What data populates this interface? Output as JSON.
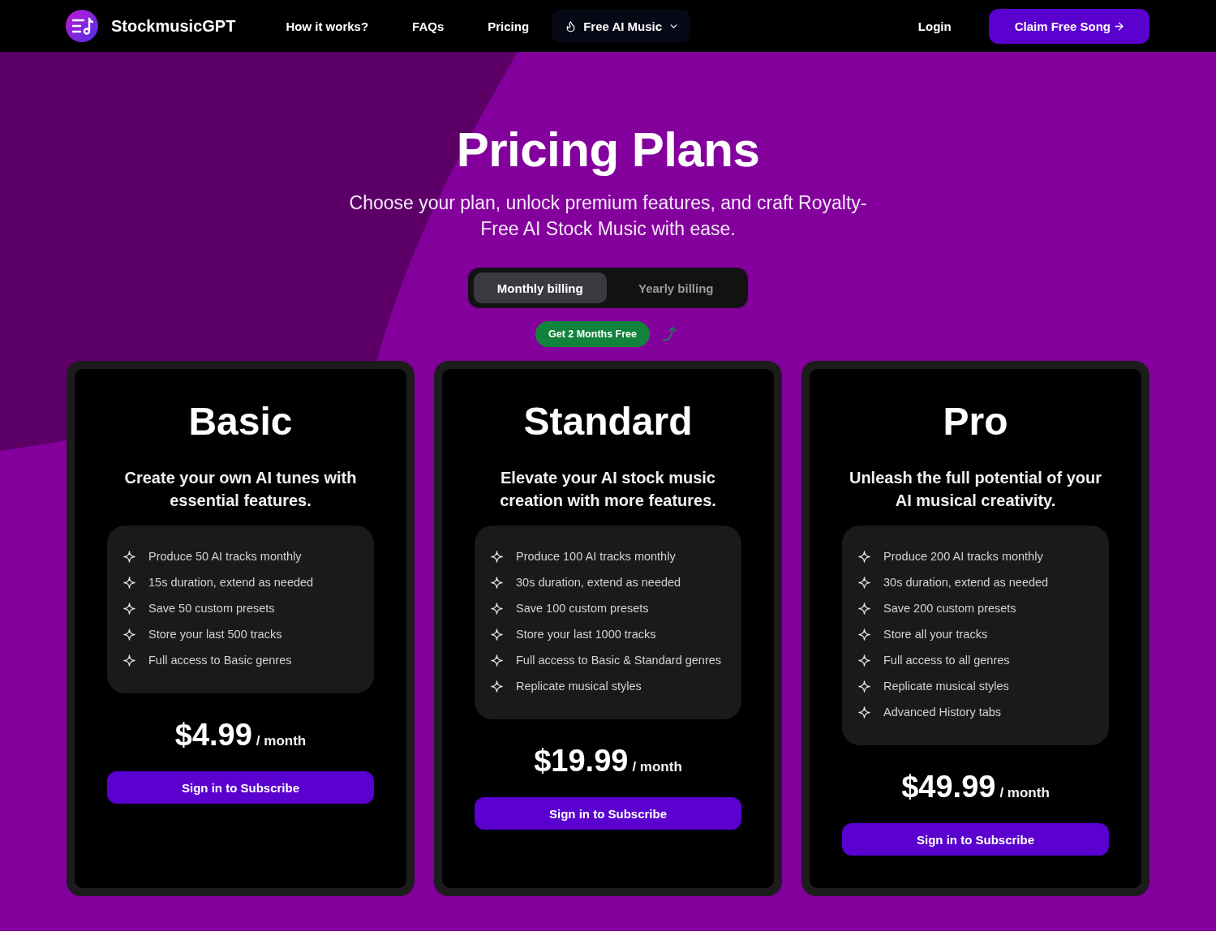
{
  "nav": {
    "brand": "StockmusicGPT",
    "links": [
      {
        "label": "How it works?",
        "kind": "link"
      },
      {
        "label": "FAQs",
        "kind": "link"
      },
      {
        "label": "Pricing",
        "kind": "link"
      },
      {
        "label": "Free AI Music",
        "kind": "dropdown"
      }
    ],
    "login": "Login",
    "cta": "Claim Free Song"
  },
  "hero": {
    "title": "Pricing Plans",
    "subtitle": "Choose your plan, unlock premium features, and craft Royalty-Free AI Stock Music with ease."
  },
  "billing": {
    "options": [
      {
        "label": "Monthly billing",
        "selected": true
      },
      {
        "label": "Yearly billing",
        "selected": false
      }
    ],
    "badge": "Get 2 Months Free"
  },
  "plans": [
    {
      "name": "Basic",
      "description": "Create your own AI tunes with essential features.",
      "features": [
        "Produce 50 AI tracks monthly",
        "15s duration, extend as needed",
        "Save 50 custom presets",
        "Store your last 500 tracks",
        "Full access to Basic genres"
      ],
      "price": "$4.99",
      "period": "/ month",
      "button": "Sign in to Subscribe"
    },
    {
      "name": "Standard",
      "description": "Elevate your AI stock music creation with more features.",
      "features": [
        "Produce 100 AI tracks monthly",
        "30s duration, extend as needed",
        "Save 100 custom presets",
        "Store your last 1000 tracks",
        "Full access to Basic & Standard genres",
        "Replicate musical styles"
      ],
      "price": "$19.99",
      "period": "/ month",
      "button": "Sign in to Subscribe"
    },
    {
      "name": "Pro",
      "description": "Unleash the full potential of your AI musical creativity.",
      "features": [
        "Produce 200 AI tracks monthly",
        "30s duration, extend as needed",
        "Save 200 custom presets",
        "Store all your tracks",
        "Full access to all genres",
        "Replicate musical styles",
        "Advanced History tabs"
      ],
      "price": "$49.99",
      "period": "/ month",
      "button": "Sign in to Subscribe"
    }
  ]
}
